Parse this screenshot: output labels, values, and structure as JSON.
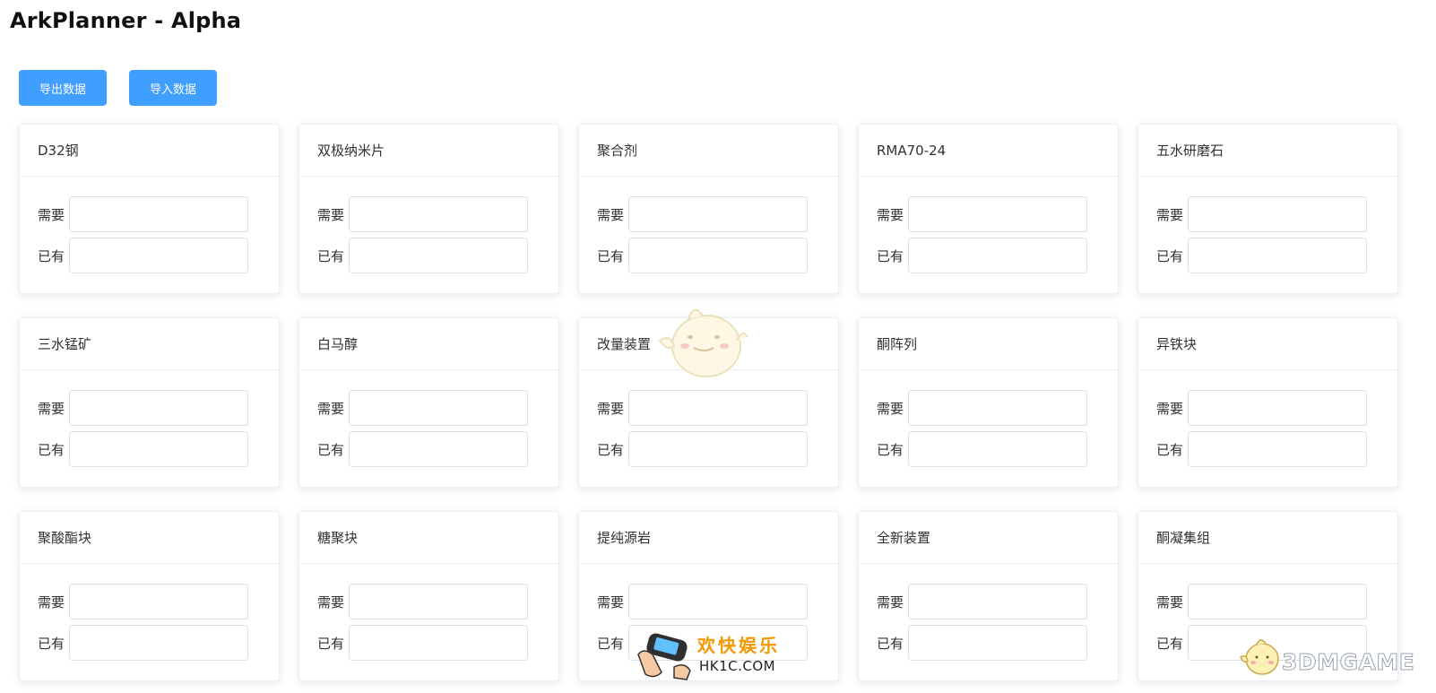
{
  "app": {
    "title": "ArkPlanner - Alpha"
  },
  "toolbar": {
    "export_label": "导出数据",
    "import_label": "导入数据"
  },
  "fields": {
    "need_label": "需要",
    "have_label": "已有"
  },
  "materials": [
    {
      "name": "D32钢",
      "need": "",
      "have": ""
    },
    {
      "name": "双极纳米片",
      "need": "",
      "have": ""
    },
    {
      "name": "聚合剂",
      "need": "",
      "have": ""
    },
    {
      "name": "RMA70-24",
      "need": "",
      "have": ""
    },
    {
      "name": "五水研磨石",
      "need": "",
      "have": ""
    },
    {
      "name": "三水锰矿",
      "need": "",
      "have": ""
    },
    {
      "name": "白马醇",
      "need": "",
      "have": ""
    },
    {
      "name": "改量装置",
      "need": "",
      "have": ""
    },
    {
      "name": "酮阵列",
      "need": "",
      "have": ""
    },
    {
      "name": "异铁块",
      "need": "",
      "have": ""
    },
    {
      "name": "聚酸酯块",
      "need": "",
      "have": ""
    },
    {
      "name": "糖聚块",
      "need": "",
      "have": ""
    },
    {
      "name": "提纯源岩",
      "need": "",
      "have": ""
    },
    {
      "name": "全新装置",
      "need": "",
      "have": ""
    },
    {
      "name": "酮凝集组",
      "need": "",
      "have": ""
    }
  ],
  "watermarks": {
    "hk1c_cn": "欢快娱乐",
    "hk1c_en": "HK1C.COM",
    "game3dm": "3DMGAME"
  },
  "colors": {
    "primary": "#409eff",
    "card_border": "#ebeef5",
    "input_border": "#dcdfe6",
    "text": "#303133"
  }
}
